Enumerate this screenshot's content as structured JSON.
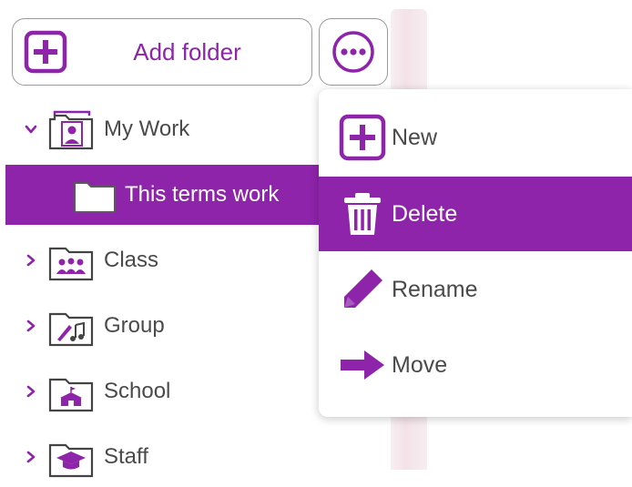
{
  "toolbar": {
    "add_folder_label": "Add folder",
    "add_icon": "plus-square-icon",
    "more_icon": "more-horizontal-circle-icon"
  },
  "tree": {
    "items": [
      {
        "label": "My Work",
        "icon": "my-work-folder-icon",
        "chevron": "expanded"
      },
      {
        "label": "This terms work",
        "icon": "folder-icon",
        "selected": true
      },
      {
        "label": "Class",
        "icon": "class-folder-icon",
        "chevron": "collapsed"
      },
      {
        "label": "Group",
        "icon": "group-folder-icon",
        "chevron": "collapsed"
      },
      {
        "label": "School",
        "icon": "school-folder-icon",
        "chevron": "collapsed"
      },
      {
        "label": "Staff",
        "icon": "staff-folder-icon",
        "chevron": "collapsed"
      }
    ]
  },
  "context_menu": {
    "items": [
      {
        "label": "New",
        "icon": "plus-square-icon"
      },
      {
        "label": "Delete",
        "icon": "trash-icon",
        "highlighted": true
      },
      {
        "label": "Rename",
        "icon": "pencil-icon"
      },
      {
        "label": "Move",
        "icon": "arrow-right-icon"
      }
    ]
  },
  "colors": {
    "accent": "#8e24aa",
    "text": "#4a4a4a",
    "border": "#9a9a9a"
  }
}
